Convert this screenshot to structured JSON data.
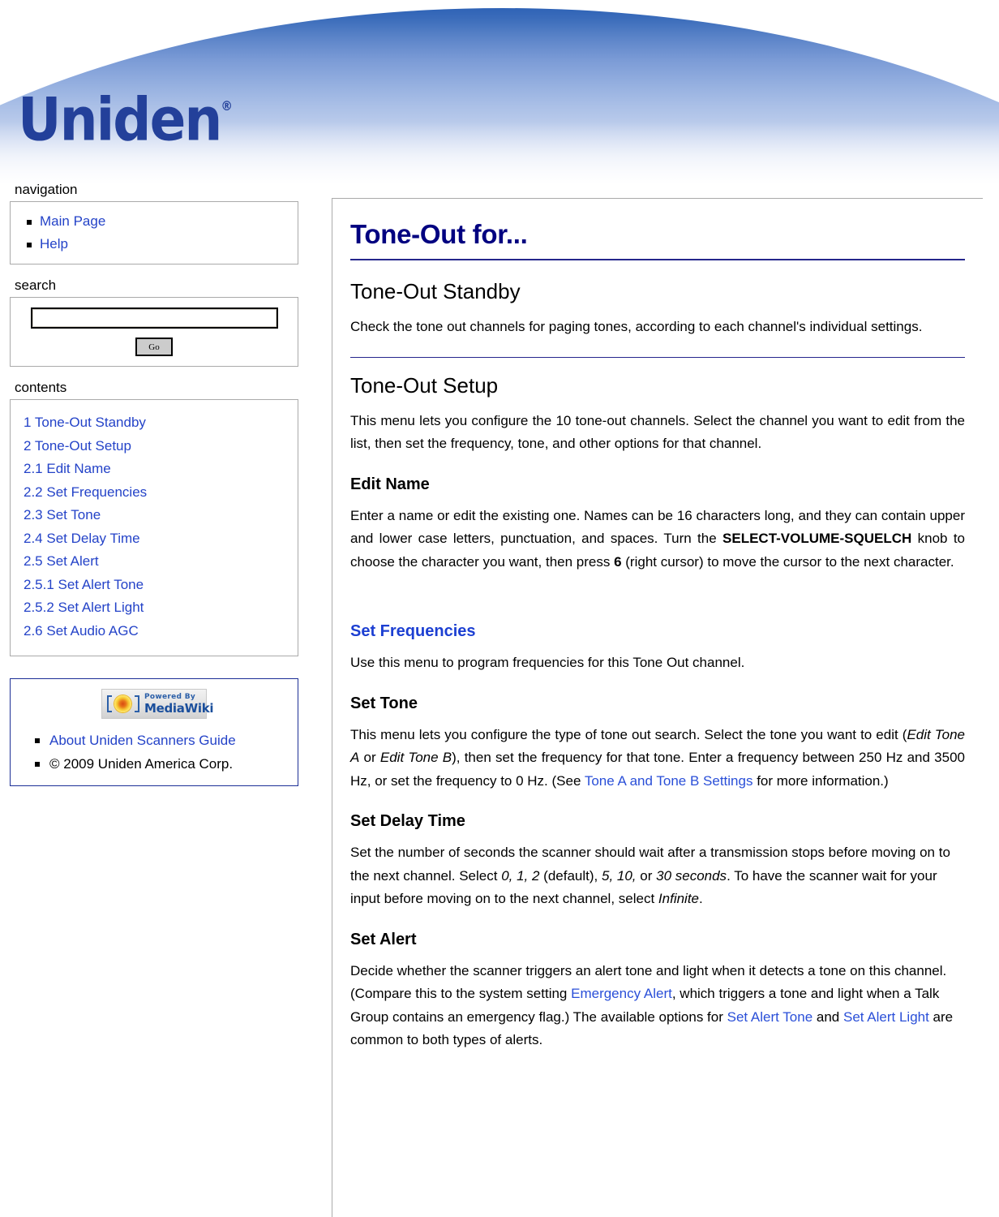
{
  "banner": {
    "logo_text": "Uniden",
    "logo_registered": "®"
  },
  "sidebar": {
    "navigation": {
      "title": "navigation",
      "items": [
        {
          "label": "Main Page"
        },
        {
          "label": "Help"
        }
      ]
    },
    "search": {
      "title": "search",
      "input_value": "",
      "input_placeholder": "",
      "go_label": "Go"
    },
    "contents": {
      "title": "contents",
      "items": [
        {
          "label": "1 Tone-Out Standby"
        },
        {
          "label": "2 Tone-Out Setup"
        },
        {
          "label": "2.1 Edit Name"
        },
        {
          "label": "2.2 Set Frequencies"
        },
        {
          "label": "2.3 Set Tone"
        },
        {
          "label": "2.4 Set Delay Time"
        },
        {
          "label": "2.5 Set Alert"
        },
        {
          "label": "2.5.1 Set Alert Tone"
        },
        {
          "label": "2.5.2 Set Alert Light"
        },
        {
          "label": "2.6 Set Audio AGC"
        }
      ]
    },
    "footer": {
      "logo_top_text": "Powered By",
      "logo_bottom_text": "MediaWiki",
      "items": [
        {
          "label": "About Uniden Scanners Guide",
          "link": true
        },
        {
          "label": "© 2009 Uniden America Corp.",
          "link": false
        }
      ]
    }
  },
  "content": {
    "title": "Tone-Out for...",
    "sections": {
      "standby_heading": "Tone-Out Standby",
      "standby_body": "Check the tone out channels for paging tones, according to each channel's individual settings.",
      "setup_heading": "Tone-Out Setup",
      "setup_body": "This menu lets you configure the 10 tone-out channels. Select the channel you want to edit from the list, then set the frequency, tone, and other options for that channel.",
      "edit_name_heading": "Edit Name",
      "edit_name_p1": "Enter a name or edit the existing one. Names can be 16 characters long, and they can contain upper and lower case letters, punctuation, and spaces. Turn the ",
      "edit_name_bold1": "SELECT-VOLUME-SQUELCH",
      "edit_name_p2": " knob to choose the character you want, then press ",
      "edit_name_bold2": "6",
      "edit_name_p3": " (right cursor) to move the cursor to the next character.",
      "set_frequencies_heading": "Set Frequencies",
      "set_frequencies_body": "Use this menu to program frequencies for this Tone Out channel.",
      "set_tone_heading": "Set Tone",
      "set_tone_p1": "This menu lets you configure the type of tone out search. Select the tone you want to edit (",
      "set_tone_i1": "Edit Tone A",
      "set_tone_p2": " or ",
      "set_tone_i2": "Edit Tone B",
      "set_tone_p3": "), then set the frequency for that tone. Enter a frequency between 250 Hz and 3500 Hz, or set the frequency to 0 Hz. (See ",
      "set_tone_link": "Tone A and Tone B Settings",
      "set_tone_p4": " for more information.)",
      "set_delay_heading": "Set Delay Time",
      "set_delay_p1": "Set the number of seconds the scanner should wait after a transmission stops before moving on to the next channel. Select ",
      "set_delay_i1": "0, 1, 2",
      "set_delay_p2": " (default), ",
      "set_delay_i2": "5, 10,",
      "set_delay_p3": " or ",
      "set_delay_i3": "30 seconds",
      "set_delay_p4": ". To have the scanner wait for your input before moving on to the next channel, select ",
      "set_delay_i4": "Infinite",
      "set_delay_p5": ".",
      "set_alert_heading": "Set Alert",
      "set_alert_p1": "Decide whether the scanner triggers an alert tone and light when it detects a tone on this channel. (Compare this to the system setting ",
      "set_alert_link1": "Emergency Alert",
      "set_alert_p2": ", which triggers a tone and light when a Talk Group contains an emergency flag.) The available options for ",
      "set_alert_link2": "Set Alert Tone",
      "set_alert_p3": " and ",
      "set_alert_link3": "Set Alert Light",
      "set_alert_p4": " are common to both types of alerts."
    }
  },
  "colors": {
    "title_navy": "#000080",
    "link_blue": "#2a4fd8",
    "rule_blue": "#25268c",
    "box_border_gray": "#aaaaaa",
    "footer_border_blue": "#1c2f96",
    "banner_blue": "#2f63b6",
    "logo_blue": "#23409a"
  }
}
